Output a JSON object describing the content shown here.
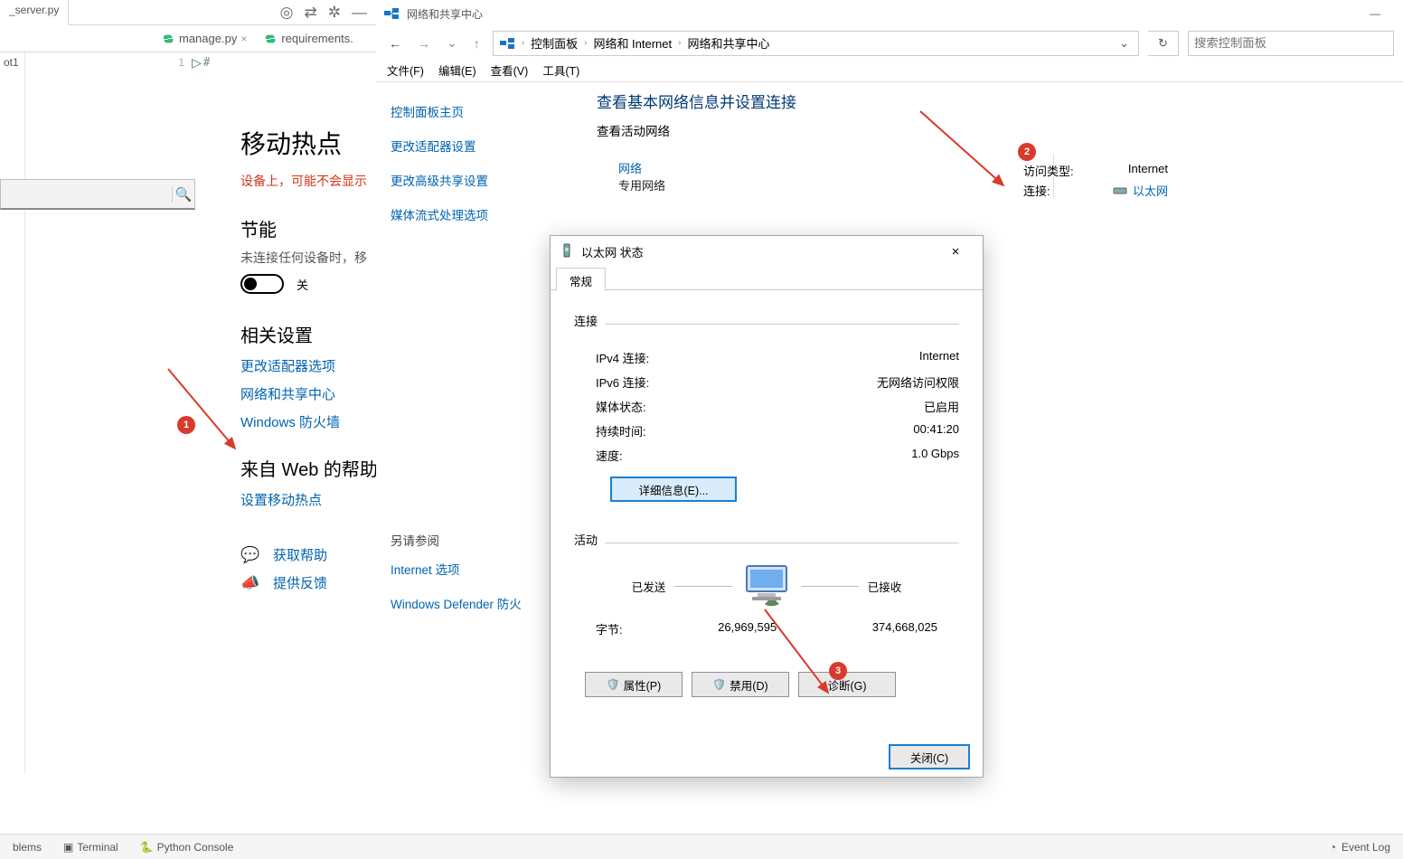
{
  "ide": {
    "tab1": "_server.py",
    "tab_manage": "manage.py",
    "tab_req": "requirements.",
    "gutter": "1",
    "code": "#!/usr/bin/python",
    "left_label": "ot1"
  },
  "icons": {
    "target": "◎",
    "equals": "⇄",
    "gear": "✲",
    "chev": "▾",
    "close": "×",
    "back": "←",
    "forward": "→",
    "drop": "⌄",
    "up": "↑",
    "refresh": "↻",
    "search": "🔍",
    "lenz": "⌕"
  },
  "settings": {
    "title": "移动热点",
    "warn": "设备上，可能不会显示",
    "section_save": "节能",
    "save_desc": "未连接任何设备时，移",
    "toggle_label": "关",
    "section_related": "相关设置",
    "link_adapter": "更改适配器选项",
    "link_share": "网络和共享中心",
    "link_firewall": "Windows 防火墙",
    "section_web": "来自 Web 的帮助",
    "link_hotspot": "设置移动热点",
    "help_label": "获取帮助",
    "feedback_label": "提供反馈"
  },
  "cp": {
    "title": "网络和共享中心",
    "addr1": "控制面板",
    "addr2": "网络和 Internet",
    "addr3": "网络和共享中心",
    "search_ph": "搜索控制面板",
    "menu_file": "文件(F)",
    "menu_edit": "编辑(E)",
    "menu_view": "查看(V)",
    "menu_tool": "工具(T)",
    "side_home": "控制面板主页",
    "side_adapter": "更改适配器设置",
    "side_adv": "更改高级共享设置",
    "side_media": "媒体流式处理选项",
    "side_also": "另请参阅",
    "side_inet": "Internet 选项",
    "side_def": "Windows Defender 防火",
    "main_h": "查看基本网络信息并设置连接",
    "main_sub": "查看活动网络",
    "net_name": "网络",
    "net_type": "专用网络",
    "access_label": "访问类型:",
    "access_val": "Internet",
    "conn_label": "连接:",
    "conn_val": "以太网"
  },
  "dlg": {
    "title": "以太网 状态",
    "tab": "常规",
    "grp_conn": "连接",
    "ipv4_l": "IPv4 连接:",
    "ipv4_v": "Internet",
    "ipv6_l": "IPv6 连接:",
    "ipv6_v": "无网络访问权限",
    "media_l": "媒体状态:",
    "media_v": "已启用",
    "dur_l": "持续时间:",
    "dur_v": "00:41:20",
    "speed_l": "速度:",
    "speed_v": "1.0 Gbps",
    "details_btn": "详细信息(E)...",
    "grp_act": "活动",
    "sent": "已发送",
    "recv": "已接收",
    "bytes_l": "字节:",
    "sent_v": "26,969,595",
    "recv_v": "374,668,025",
    "prop": "属性(P)",
    "disable": "禁用(D)",
    "diag": "诊断(G)",
    "close": "关闭(C)"
  },
  "badges": {
    "b1": "1",
    "b2": "2",
    "b3": "3"
  },
  "bottom": {
    "problems": "blems",
    "terminal": "Terminal",
    "pycon": "Python Console",
    "event": "Event Log"
  }
}
